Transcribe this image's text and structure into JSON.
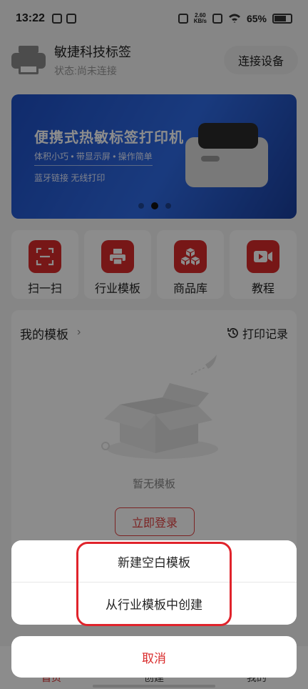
{
  "status_bar": {
    "time": "13:22",
    "net_speed_value": "2.60",
    "net_speed_unit": "KB/s",
    "battery": "65%"
  },
  "header": {
    "device_name": "敏捷科技标签",
    "status": "状态:尚未连接",
    "connect_button": "连接设备",
    "printer_icon": "printer-icon"
  },
  "banner": {
    "title": "便携式热敏标签打印机",
    "features": "体积小巧 • 带显示屏 • 操作简单",
    "subtitle": "蓝牙链接 无线打印",
    "slides": 3,
    "active_slide": 2
  },
  "quick_actions": [
    {
      "label": "扫一扫",
      "icon": "scan-icon"
    },
    {
      "label": "行业模板",
      "icon": "printer-icon"
    },
    {
      "label": "商品库",
      "icon": "boxes-icon"
    },
    {
      "label": "教程",
      "icon": "video-icon"
    }
  ],
  "templates": {
    "title": "我的模板",
    "arrow": "›",
    "print_record": "打印记录",
    "empty_text": "暂无模板",
    "login_button": "立即登录"
  },
  "tabbar": {
    "tabs": [
      {
        "label": "首页",
        "active": true
      },
      {
        "label": "创建",
        "active": false
      },
      {
        "label": "我的",
        "active": false
      }
    ]
  },
  "action_sheet": {
    "options": [
      "新建空白模板",
      "从行业模板中创建"
    ],
    "cancel": "取消"
  },
  "colors": {
    "accent": "#d92b2b",
    "highlight_frame": "#e0232b",
    "banner": "#2f6be6"
  }
}
